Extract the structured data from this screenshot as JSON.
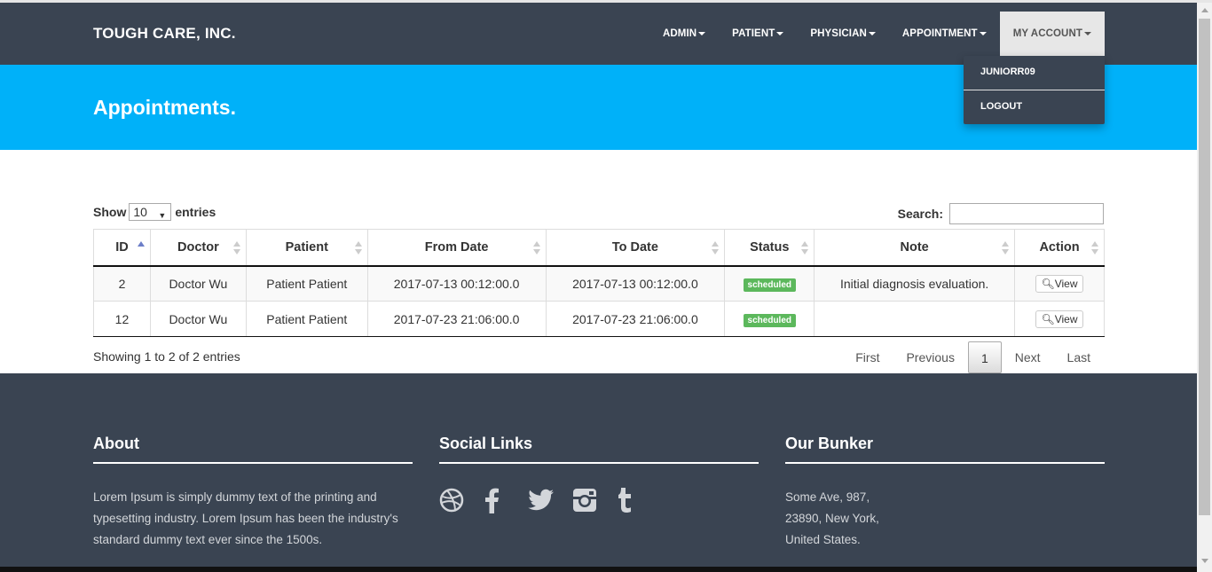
{
  "navbar": {
    "brand": "TOUGH CARE, INC.",
    "items": [
      {
        "label": "ADMIN"
      },
      {
        "label": "PATIENT"
      },
      {
        "label": "PHYSICIAN"
      },
      {
        "label": "APPOINTMENT"
      },
      {
        "label": "MY ACCOUNT"
      }
    ],
    "dropdown": [
      "JUNIORR09",
      "LOGOUT"
    ]
  },
  "header": {
    "title": "Appointments."
  },
  "table_controls": {
    "show_label": "Show",
    "entries_value": "10",
    "entries_label": "entries",
    "search_label": "Search:",
    "search_value": ""
  },
  "table": {
    "columns": [
      "ID",
      "Doctor",
      "Patient",
      "From Date",
      "To Date",
      "Status",
      "Note",
      "Action"
    ],
    "rows": [
      {
        "id": "2",
        "doctor": "Doctor Wu",
        "patient": "Patient Patient",
        "from": "2017-07-13 00:12:00.0",
        "to": "2017-07-13 00:12:00.0",
        "status": "scheduled",
        "note": "Initial diagnosis evaluation.",
        "action": "View"
      },
      {
        "id": "12",
        "doctor": "Doctor Wu",
        "patient": "Patient Patient",
        "from": "2017-07-23 21:06:00.0",
        "to": "2017-07-23 21:06:00.0",
        "status": "scheduled",
        "note": "",
        "action": "View"
      }
    ],
    "info": "Showing 1 to 2 of 2 entries",
    "pager": {
      "first": "First",
      "previous": "Previous",
      "current": "1",
      "next": "Next",
      "last": "Last"
    }
  },
  "footer": {
    "about": {
      "title": "About",
      "text": "Lorem Ipsum is simply dummy text of the printing and typesetting industry. Lorem Ipsum has been the industry's standard dummy text ever since the 1500s."
    },
    "social": {
      "title": "Social Links",
      "icons": [
        "dribbble-icon",
        "facebook-icon",
        "twitter-icon",
        "instagram-icon",
        "tumblr-icon"
      ]
    },
    "bunker": {
      "title": "Our Bunker",
      "line1": "Some Ave, 987,",
      "line2": "23890, New York,",
      "line3": "United States."
    }
  },
  "colors": {
    "navbar": "#3a4452",
    "header": "#00b1f9",
    "status_badge": "#5cb85c"
  }
}
